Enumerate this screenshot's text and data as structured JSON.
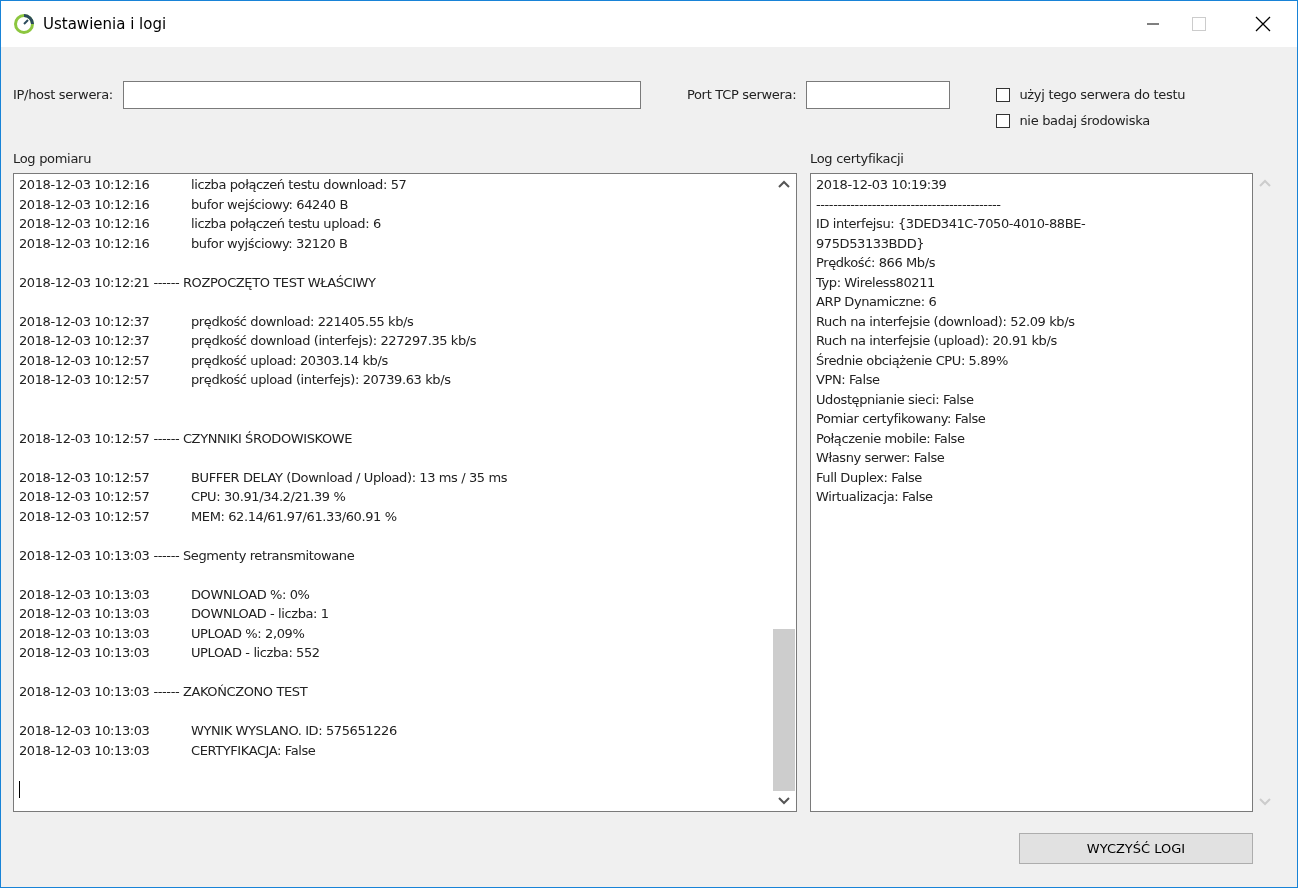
{
  "window": {
    "title": "Ustawienia i logi",
    "controls": [
      {
        "kind": "minimize",
        "disabled": false
      },
      {
        "kind": "maximize",
        "disabled": true
      },
      {
        "kind": "close",
        "disabled": false
      }
    ]
  },
  "server": {
    "host_label": "IP/host serwera:",
    "port_label": "Port TCP serwera:"
  },
  "options": [
    {
      "label": "użyj tego serwera do testu",
      "checked": false
    },
    {
      "label": "nie badaj środowiska",
      "checked": false
    }
  ],
  "measurement_log": {
    "title": "Log pomiaru",
    "lines": [
      {
        "kind": "entry",
        "time": "2018-12-03 10:12:16",
        "text": "liczba połączeń testu download: 57"
      },
      {
        "kind": "entry",
        "time": "2018-12-03 10:12:16",
        "text": "bufor wejściowy: 64240 B"
      },
      {
        "kind": "entry",
        "time": "2018-12-03 10:12:16",
        "text": "liczba połączeń testu upload: 6"
      },
      {
        "kind": "entry",
        "time": "2018-12-03 10:12:16",
        "text": "bufor wyjściowy: 32120 B"
      },
      {
        "kind": "blank"
      },
      {
        "kind": "header",
        "time": "2018-12-03 10:12:21",
        "text": "------ ROZPOCZĘTO TEST WŁAŚCIWY"
      },
      {
        "kind": "blank"
      },
      {
        "kind": "entry",
        "time": "2018-12-03 10:12:37",
        "text": "prędkość download: 221405.55 kb/s"
      },
      {
        "kind": "entry",
        "time": "2018-12-03 10:12:37",
        "text": "prędkość download (interfejs): 227297.35 kb/s"
      },
      {
        "kind": "entry",
        "time": "2018-12-03 10:12:57",
        "text": "prędkość upload: 20303.14 kb/s"
      },
      {
        "kind": "entry",
        "time": "2018-12-03 10:12:57",
        "text": "prędkość upload (interfejs): 20739.63 kb/s"
      },
      {
        "kind": "blank"
      },
      {
        "kind": "blank"
      },
      {
        "kind": "header",
        "time": "2018-12-03 10:12:57",
        "text": "------ CZYNNIKI ŚRODOWISKOWE"
      },
      {
        "kind": "blank"
      },
      {
        "kind": "entry",
        "time": "2018-12-03 10:12:57",
        "text": "BUFFER DELAY (Download / Upload): 13 ms / 35 ms"
      },
      {
        "kind": "entry",
        "time": "2018-12-03 10:12:57",
        "text": "CPU: 30.91/34.2/21.39 %"
      },
      {
        "kind": "entry",
        "time": "2018-12-03 10:12:57",
        "text": "MEM: 62.14/61.97/61.33/60.91 %"
      },
      {
        "kind": "blank"
      },
      {
        "kind": "header",
        "time": "2018-12-03 10:13:03",
        "text": "------ Segmenty retransmitowane"
      },
      {
        "kind": "blank"
      },
      {
        "kind": "entry",
        "time": "2018-12-03 10:13:03",
        "text": "DOWNLOAD %: 0%"
      },
      {
        "kind": "entry",
        "time": "2018-12-03 10:13:03",
        "text": "DOWNLOAD - liczba: 1"
      },
      {
        "kind": "entry",
        "time": "2018-12-03 10:13:03",
        "text": "UPLOAD %: 2,09%"
      },
      {
        "kind": "entry",
        "time": "2018-12-03 10:13:03",
        "text": "UPLOAD - liczba: 552"
      },
      {
        "kind": "blank"
      },
      {
        "kind": "header",
        "time": "2018-12-03 10:13:03",
        "text": "------ ZAKOŃCZONO TEST"
      },
      {
        "kind": "blank"
      },
      {
        "kind": "entry",
        "time": "2018-12-03 10:13:03",
        "text": "WYNIK WYSLANO. ID: 575651226"
      },
      {
        "kind": "entry",
        "time": "2018-12-03 10:13:03",
        "text": "CERTYFIKACJA: False"
      },
      {
        "kind": "blank"
      },
      {
        "kind": "cursor"
      }
    ]
  },
  "certification_log": {
    "title": "Log certyfikacji",
    "lines": [
      "2018-12-03 10:19:39",
      "-------------------------------------------",
      "ID interfejsu: {3DED341C-7050-4010-88BE-",
      "975D53133BDD}",
      "Prędkość: 866 Mb/s",
      "Typ: Wireless80211",
      "ARP Dynamiczne: 6",
      "Ruch na interfejsie (download): 52.09 kb/s",
      "Ruch na interfejsie (upload): 20.91 kb/s",
      "Średnie obciążenie CPU: 5.89%",
      "VPN: False",
      "Udostępnianie sieci: False",
      "Pomiar certyfikowany: False",
      "Połączenie mobile: False",
      "Własny serwer: False",
      "Full Duplex: False",
      "Wirtualizacja: False"
    ]
  },
  "clear_button": "WYCZYŚĆ LOGI"
}
